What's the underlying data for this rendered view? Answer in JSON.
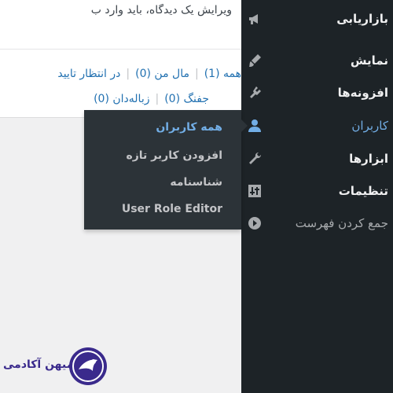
{
  "notice": {
    "text": "ویرایش یک دیدگاه، باید وارد ب"
  },
  "views": {
    "row1": [
      {
        "label": "همه (1)",
        "current": true
      },
      {
        "label": "مال من (0)",
        "current": false
      },
      {
        "label": "در انتظار تایید",
        "current": false
      }
    ],
    "row2": [
      {
        "label": "جفنگ (0)",
        "current": false
      },
      {
        "label": "زباله‌دان (0)",
        "current": false
      }
    ]
  },
  "sidebar": {
    "items": [
      {
        "label": "بازاریابی",
        "icon": "megaphone-icon"
      },
      {
        "label": "نمایش",
        "icon": "paintbrush-icon"
      },
      {
        "label": "افزونه‌ها",
        "icon": "plugin-icon"
      },
      {
        "label": "کاربران",
        "icon": "users-icon"
      },
      {
        "label": "ابزارها",
        "icon": "wrench-icon"
      },
      {
        "label": "تنظیمات",
        "icon": "settings-icon"
      },
      {
        "label": "جمع کردن فهرست",
        "icon": "collapse-icon"
      }
    ]
  },
  "submenu": {
    "items": [
      {
        "label": "همه کاربران"
      },
      {
        "label": "افزودن کاربر تازه"
      },
      {
        "label": "شناسنامه"
      },
      {
        "label": "User Role Editor"
      }
    ]
  },
  "logo": {
    "text": "میهن آکادمی"
  },
  "colors": {
    "sidebar_bg": "#1d2327",
    "submenu_bg": "#2c3338",
    "accent": "#72aee6",
    "link": "#2271b1",
    "brand": "#3a2a8c"
  }
}
